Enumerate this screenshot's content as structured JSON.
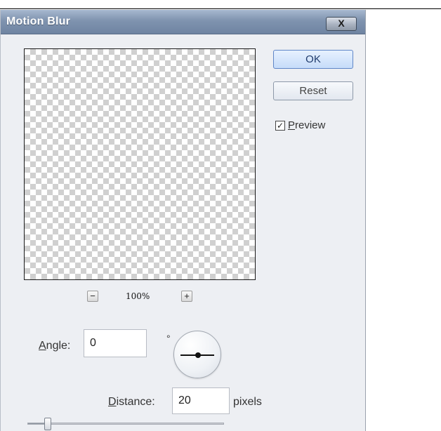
{
  "dialog": {
    "title": "Motion Blur",
    "close_label": "X"
  },
  "buttons": {
    "ok": "OK",
    "reset": "Reset"
  },
  "preview": {
    "checkbox_checked": true,
    "checkbox_mark": "✓",
    "label_first": "P",
    "label_rest": "review"
  },
  "zoom": {
    "minus": "−",
    "level": "100%",
    "plus": "+"
  },
  "angle": {
    "label_first": "A",
    "label_rest": "ngle:",
    "value": "0",
    "unit": "°"
  },
  "distance": {
    "label_first": "D",
    "label_rest": "istance:",
    "value": "20",
    "unit": "pixels",
    "slider_fraction": 0.1
  }
}
